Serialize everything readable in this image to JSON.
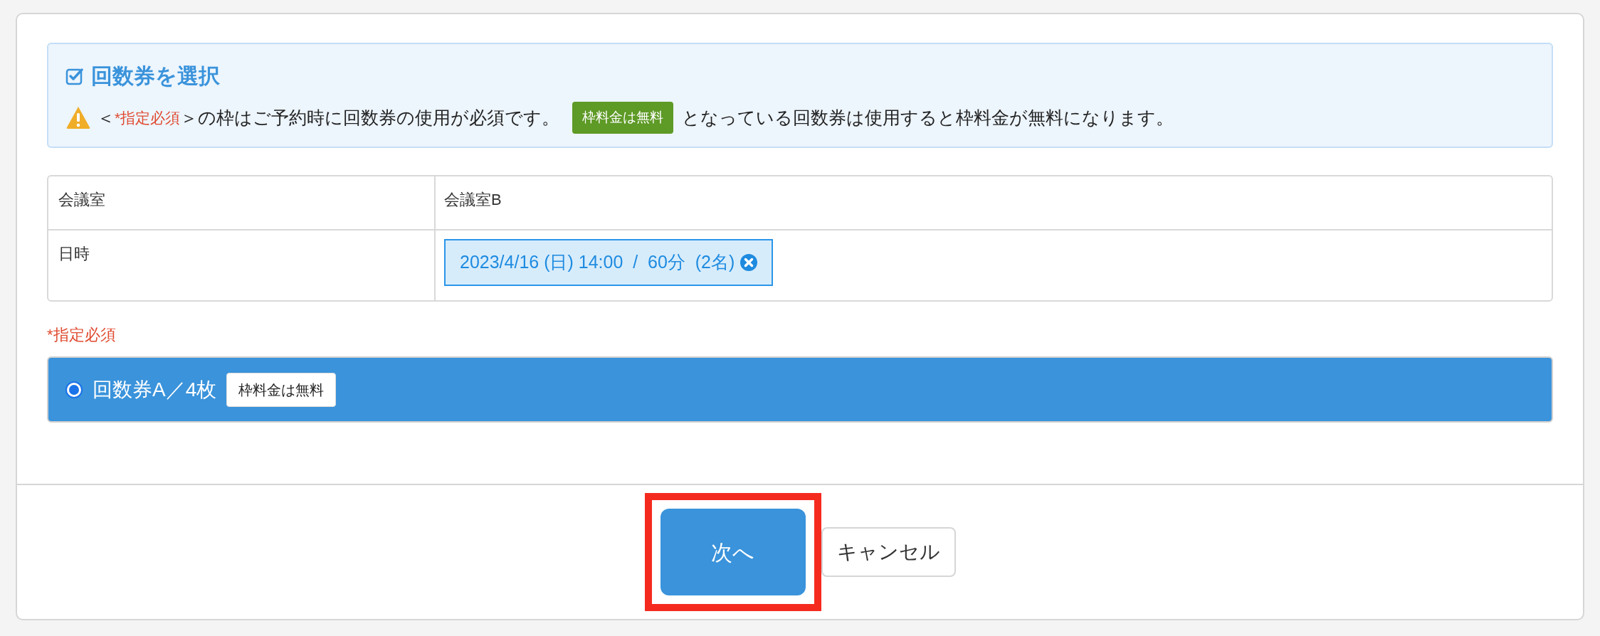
{
  "notice": {
    "title": "回数券を選択",
    "open_bracket": "＜",
    "required": "*指定必須",
    "after_required": "＞の枠はご予約時に回数券の使用が必須です。",
    "badge": "枠料金は無料",
    "after_badge": "となっている回数券は使用すると枠料金が無料になります。"
  },
  "table": {
    "rows": [
      {
        "label": "会議室",
        "value": "会議室B",
        "kind": "text"
      },
      {
        "label": "日時",
        "value": "2023/4/16 (日) 14:00  /  60分  (2名)",
        "kind": "chip"
      }
    ]
  },
  "required_label": "*指定必須",
  "tickets": [
    {
      "label": "回数券A／4枚",
      "badge": "枠料金は無料",
      "selected": true
    }
  ],
  "buttons": [
    {
      "label": "次へ",
      "kind": "primary",
      "highlighted": true
    },
    {
      "label": "キャンセル",
      "kind": "secondary",
      "highlighted": false
    }
  ]
}
